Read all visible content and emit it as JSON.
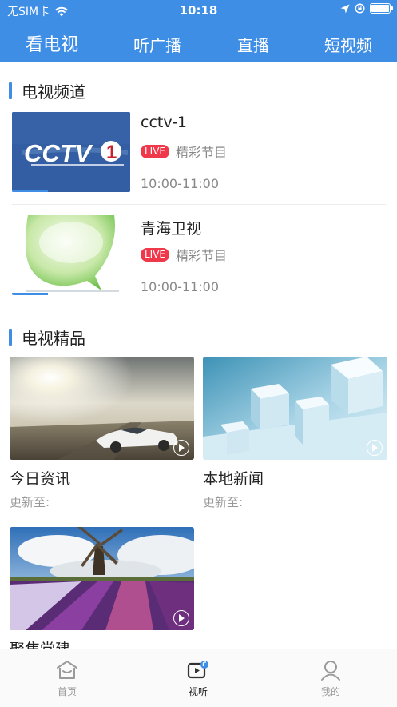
{
  "status": {
    "carrier": "无SIM卡",
    "time": "10:18"
  },
  "tabs": [
    {
      "label": "看电视",
      "active": true
    },
    {
      "label": "听广播",
      "active": false
    },
    {
      "label": "直播",
      "active": false
    },
    {
      "label": "短视频",
      "active": false
    }
  ],
  "tv_channels": {
    "title": "电视频道",
    "items": [
      {
        "name": "cctv-1",
        "live": "LIVE",
        "program": "精彩节目",
        "time": "10:00-11:00",
        "logo_text": "CCTV",
        "logo_num": "1",
        "progress": 0.3
      },
      {
        "name": "青海卫视",
        "live": "LIVE",
        "program": "精彩节目",
        "time": "10:00-11:00",
        "progress": 0.3
      }
    ]
  },
  "tv_boutique": {
    "title": "电视精品",
    "items": [
      {
        "title": "今日资讯",
        "updated": "更新至:"
      },
      {
        "title": "本地新闻",
        "updated": "更新至:"
      },
      {
        "title": "聚焦党建",
        "updated": ""
      }
    ]
  },
  "tabbar": [
    {
      "label": "首页",
      "icon": "home-icon",
      "active": false
    },
    {
      "label": "视听",
      "icon": "video-icon",
      "active": true
    },
    {
      "label": "我的",
      "icon": "profile-icon",
      "active": false
    }
  ],
  "colors": {
    "primary": "#3f8ee6",
    "live": "#f0384b"
  }
}
